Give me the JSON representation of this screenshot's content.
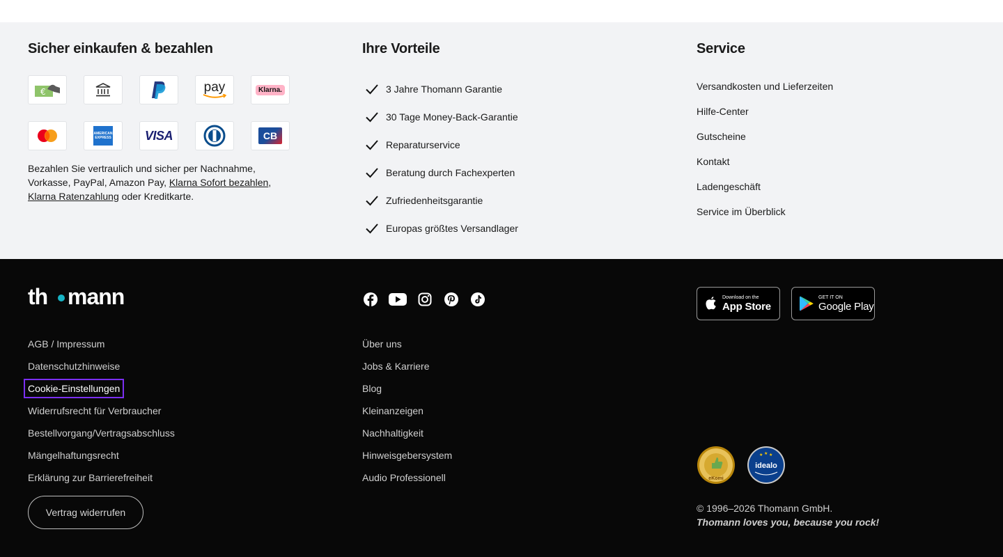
{
  "secure": {
    "title": "Sicher einkaufen & bezahlen",
    "methods": [
      {
        "icon": "cash-on-delivery-icon"
      },
      {
        "icon": "bank-transfer-icon"
      },
      {
        "icon": "paypal-icon"
      },
      {
        "icon": "amazon-pay-icon",
        "label": "pay"
      },
      {
        "icon": "klarna-icon",
        "label": "Klarna."
      },
      {
        "icon": "mastercard-icon"
      },
      {
        "icon": "american-express-icon",
        "label": "AMERICAN EXPRESS"
      },
      {
        "icon": "visa-icon",
        "label": "VISA"
      },
      {
        "icon": "diners-club-icon"
      },
      {
        "icon": "carte-bancaire-icon",
        "label": "CB"
      }
    ],
    "text_pre": "Bezahlen Sie vertraulich und sicher per Nachnahme, Vorkasse, PayPal, Amazon Pay, ",
    "link_sofort": "Klarna Sofort bezahlen",
    "text_comma": ",",
    "link_raten": "Klarna Ratenzahlung",
    "text_post": " oder Kreditkarte."
  },
  "benefits": {
    "title": "Ihre Vorteile",
    "items": [
      "3 Jahre Thomann Garantie",
      "30 Tage Money-Back-Garantie",
      "Reparaturservice",
      "Beratung durch Fachexperten",
      "Zufriedenheitsgarantie",
      "Europas größtes Versandlager"
    ]
  },
  "service": {
    "title": "Service",
    "links": [
      "Versandkosten und Lieferzeiten",
      "Hilfe-Center",
      "Gutscheine",
      "Kontakt",
      "Ladengeschäft",
      "Service im Überblick"
    ]
  },
  "footer": {
    "logo": "thomann",
    "legal_links": [
      "AGB / Impressum",
      "Datenschutzhinweise",
      "Cookie-Einstellungen",
      "Widerrufsrecht für Verbraucher",
      "Bestellvorgang/Vertragsabschluss",
      "Mängelhaftungsrecht",
      "Erklärung zur Barrierefreiheit"
    ],
    "company_links": [
      "Über uns",
      "Jobs & Karriere",
      "Blog",
      "Kleinanzeigen",
      "Nachhaltigkeit",
      "Hinweisgebersystem",
      "Audio Professionell"
    ],
    "social": [
      "facebook-icon",
      "youtube-icon",
      "instagram-icon",
      "pinterest-icon",
      "tiktok-icon"
    ],
    "app_store": {
      "small": "Download on the",
      "big": "App Store"
    },
    "google_play": {
      "small": "GET IT ON",
      "big": "Google Play"
    },
    "badges": [
      {
        "icon": "ekomi-badge-icon",
        "label": "eKomi"
      },
      {
        "icon": "idealo-partner-badge-icon",
        "label": "idealo"
      }
    ],
    "copyright": "© 1996–2026 Thomann GmbH.",
    "slogan": "Thomann loves you, because you rock!",
    "revoke_button": "Vertrag widerrufen"
  },
  "colors": {
    "upper_bg": "#f2f3f5",
    "footer_bg": "#080808",
    "accent": "#17b3c4",
    "focus": "#7b2ff2"
  }
}
